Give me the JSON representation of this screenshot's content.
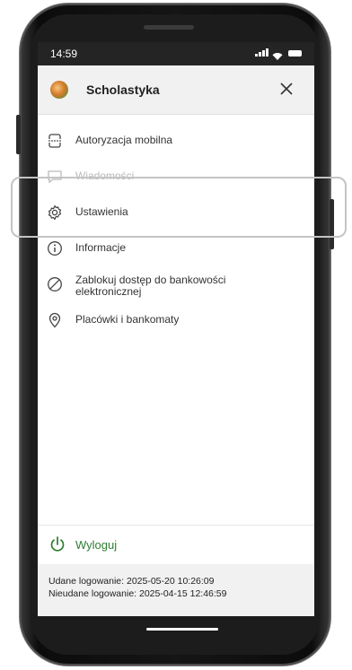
{
  "status_bar": {
    "time": "14:59"
  },
  "header": {
    "user_name": "Scholastyka",
    "close_label": "×"
  },
  "menu": {
    "items": [
      {
        "label": "Autoryzacja mobilna",
        "icon": "mobile-authorization-icon"
      },
      {
        "label": "Wiadomości",
        "icon": "message-icon"
      },
      {
        "label": "Ustawienia",
        "icon": "gear-icon"
      },
      {
        "label": "Informacje",
        "icon": "info-icon"
      },
      {
        "label": "Zablokuj dostęp do bankowości elektronicznej",
        "icon": "block-icon"
      },
      {
        "label": "Placówki i bankomaty",
        "icon": "location-pin-icon"
      }
    ]
  },
  "footer": {
    "logout_label": "Wyloguj",
    "successful_login": "Udane logowanie: 2025-05-20 10:26:09",
    "failed_login": "Nieudane logowanie: 2025-04-15 12:46:59"
  },
  "colors": {
    "accent": "#2e7d32",
    "header_bg": "#f1f1f1",
    "status_bar_bg": "#242424"
  }
}
